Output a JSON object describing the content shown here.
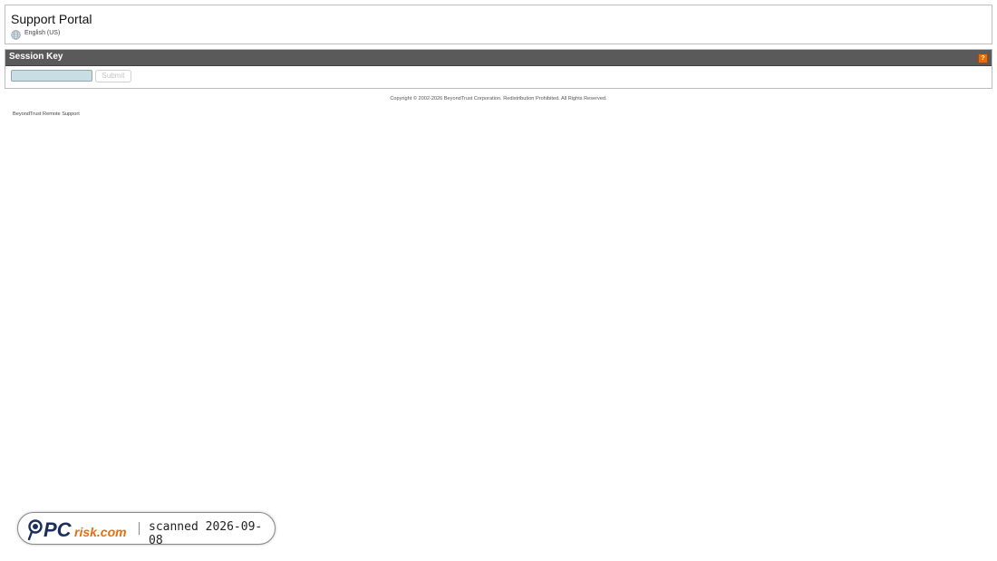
{
  "header": {
    "title": "Support Portal",
    "language": "English (US)"
  },
  "session": {
    "panel_title": "Session Key",
    "help_label": "?",
    "input_value": "",
    "submit_label": "Submit"
  },
  "footer": {
    "copyright": "Copyright © 2002-2026 BeyondTrust Corporation. Redistribution Prohibited. All Rights Reserved.",
    "product": "BeyondTrust Remote Support"
  },
  "watermark": {
    "logo_text": "PCrisk.com",
    "scanned": "scanned 2026-09-08"
  },
  "colors": {
    "session_bar": "#5a5a5a",
    "help_accent": "#e36f12",
    "input_bg": "#c9dde5"
  },
  "icons": {
    "language": "globe-icon",
    "help": "help-icon"
  }
}
